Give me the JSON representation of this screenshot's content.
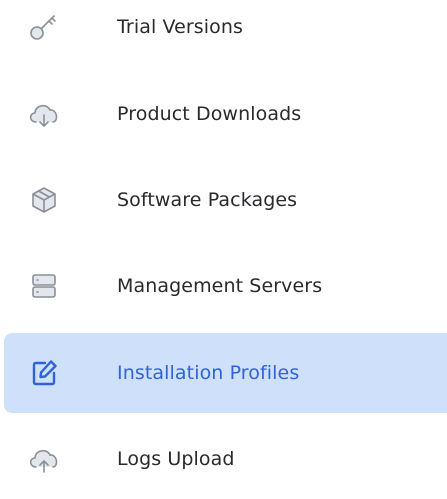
{
  "nav": {
    "items": [
      {
        "label": "Trial Versions",
        "icon": "key-icon",
        "active": false
      },
      {
        "label": "Product Downloads",
        "icon": "cloud-download-icon",
        "active": false
      },
      {
        "label": "Software Packages",
        "icon": "package-icon",
        "active": false
      },
      {
        "label": "Management Servers",
        "icon": "server-icon",
        "active": false
      },
      {
        "label": "Installation Profiles",
        "icon": "edit-icon",
        "active": true
      },
      {
        "label": "Logs Upload",
        "icon": "cloud-upload-icon",
        "active": false
      }
    ]
  },
  "colors": {
    "active_background": "#cfe0fb",
    "active_text": "#2f63d8",
    "text": "#2a2a2e",
    "icon": "#8b8f96"
  }
}
